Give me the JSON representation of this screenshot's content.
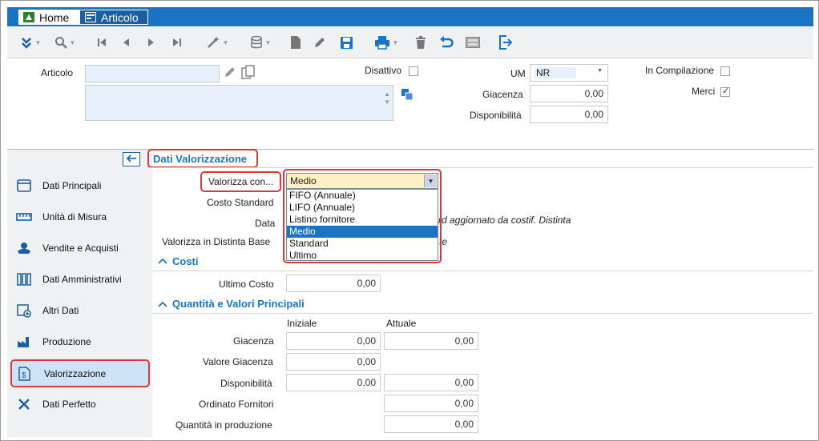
{
  "tabs": [
    {
      "label": "Home"
    },
    {
      "label": "Articolo"
    }
  ],
  "header": {
    "articolo_label": "Articolo",
    "disattivo_label": "Disattivo",
    "um_label": "UM",
    "um_value": "NR",
    "in_compilazione_label": "In Compilazione",
    "giacenza_label": "Giacenza",
    "giacenza_value": "0,00",
    "disponibilita_label": "Disponibilità",
    "disponibilita_value": "0,00",
    "merci_label": "Merci"
  },
  "sidebar": {
    "items": [
      {
        "label": "Dati Principali",
        "icon": "card-icon"
      },
      {
        "label": "Unità di Misura",
        "icon": "ruler-icon"
      },
      {
        "label": "Vendite e Acquisti",
        "icon": "handshake-icon"
      },
      {
        "label": "Dati Amministrativi",
        "icon": "binders-icon"
      },
      {
        "label": "Altri Dati",
        "icon": "box-add-icon"
      },
      {
        "label": "Produzione",
        "icon": "factory-icon"
      },
      {
        "label": "Valorizzazione",
        "icon": "valuation-icon"
      },
      {
        "label": "Dati Perfetto",
        "icon": "tools-icon"
      }
    ],
    "active_index": 6
  },
  "valorizzazione": {
    "title": "Dati Valorizzazione",
    "valorizza_con_label": "Valorizza con...",
    "valorizza_con_value": "Medio",
    "options": [
      "FIFO (Annuale)",
      "LIFO (Annuale)",
      "Listino fornitore",
      "Medio",
      "Standard",
      "Ultimo"
    ],
    "selected_option": "Medio",
    "costo_standard_label": "Costo Standard",
    "data_label": "Data",
    "data_note": "rd aggiornato da costif. Distinta",
    "valorizza_distinta_label": "Valorizza in Distinta Base",
    "valorizza_distinta_suffix": "te"
  },
  "costi": {
    "title": "Costi",
    "ultimo_costo_label": "Ultimo Costo",
    "ultimo_costo_value": "0,00"
  },
  "quantita": {
    "title": "Quantità e Valori Principali",
    "col_iniziale": "Iniziale",
    "col_attuale": "Attuale",
    "rows": [
      {
        "label": "Giacenza",
        "iniziale": "0,00",
        "attuale": "0,00"
      },
      {
        "label": "Valore Giacenza",
        "iniziale": "0,00",
        "attuale": null
      },
      {
        "label": "Disponibilità",
        "iniziale": "0,00",
        "attuale": "0,00"
      },
      {
        "label": "Ordinato Fornitori",
        "iniziale": null,
        "attuale": "0,00"
      },
      {
        "label": "Quantità in produzione",
        "iniziale": null,
        "attuale": "0,00"
      }
    ]
  },
  "colors": {
    "accent": "#1b73c4",
    "highlight": "#d83a3a",
    "combo_bg": "#fff1c4"
  }
}
